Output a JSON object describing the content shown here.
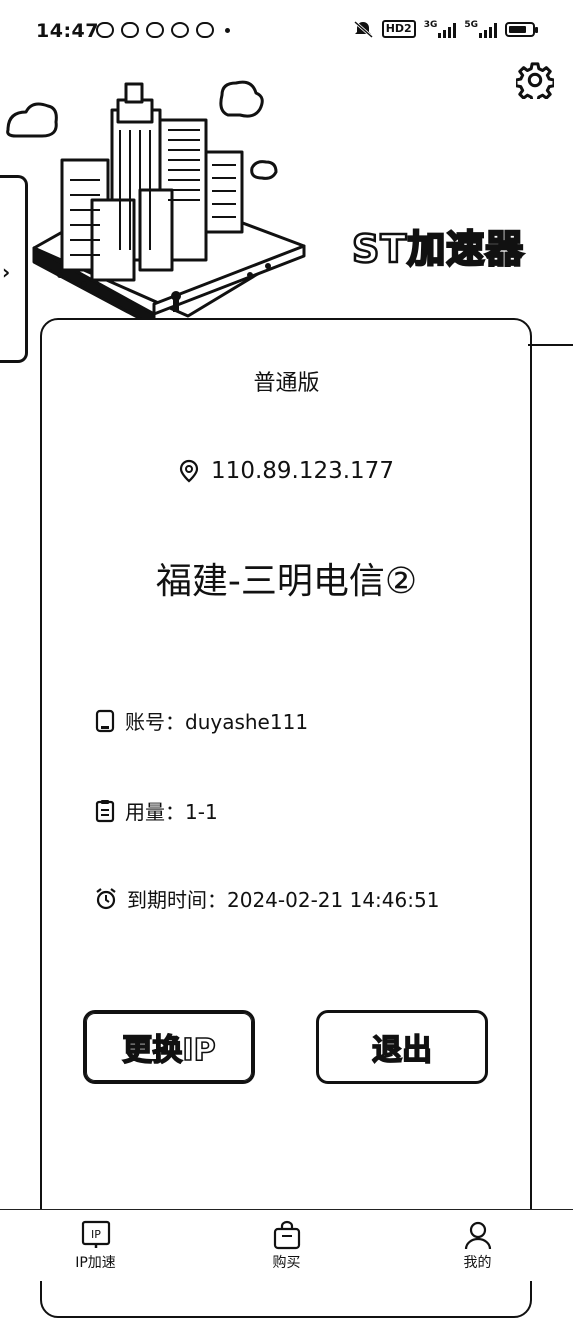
{
  "status_bar": {
    "time": "14:47",
    "network_tag": "HD2",
    "signal_1_label": "3G",
    "signal_2_label": "5G",
    "battery_level": 0.75
  },
  "header": {
    "logo_text": "ST加速器",
    "settings_icon": "gear-icon",
    "side_tab_arrow": "›"
  },
  "card": {
    "plan_name": "普通版",
    "ip_address": "110.89.123.177",
    "location_icon": "location-pin-icon",
    "location_name": "福建-三明电信②",
    "account_label": "账号：",
    "account_value": "duyashe111",
    "usage_label": "用量：",
    "usage_value": "1-1",
    "expiry_label": "到期时间：",
    "expiry_value": "2024-02-21 14:46:51"
  },
  "actions": {
    "change_ip_label": "更换IP",
    "logout_label": "退出"
  },
  "bottom_nav": {
    "items": [
      {
        "label": "IP加速",
        "icon": "ip-icon"
      },
      {
        "label": "购买",
        "icon": "shopping-bag-icon"
      },
      {
        "label": "我的",
        "icon": "user-icon"
      }
    ]
  }
}
